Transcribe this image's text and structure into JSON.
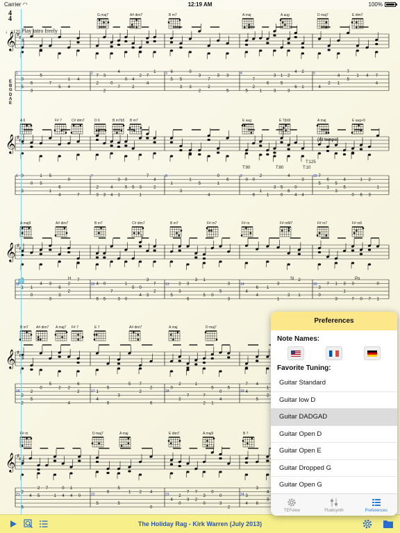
{
  "status": {
    "carrier": "Carrier",
    "time": "12:19 AM",
    "battery": "100%"
  },
  "score": {
    "time_signature_top": "4",
    "time_signature_bottom": "4",
    "tempo": "♩=125",
    "intro_text": "Play intro freely",
    "tab_strings": "E B G D A E",
    "rows": [
      {
        "chords": [
          "G maj7",
          "A# dim7",
          "B m7",
          "A maj",
          "A aug",
          "D maj7",
          "E dim7"
        ],
        "measures": [
          "1",
          "2",
          "3",
          "4",
          "5"
        ]
      },
      {
        "chords": [
          "A 6",
          "F# 7",
          "C# dim7",
          "D 6",
          "B m7b5",
          "B m7",
          "E aug",
          "E 7(b9)",
          "A maj",
          "E aug+9"
        ],
        "measures": [
          "6",
          "7",
          "8",
          "9",
          "10"
        ]
      },
      {
        "chords": [
          "A maj9",
          "A# dim7",
          "B m7",
          "C# dim7",
          "B m7",
          "F# m7",
          "F# m",
          "F# mM7",
          "F# m7",
          "F# m6"
        ],
        "measures": [
          "11",
          "12",
          "13",
          "14",
          "15"
        ]
      },
      {
        "chords": [
          "B m7",
          "A# dim7",
          "A maj7",
          "F# 7",
          "E 7",
          "A# dim7",
          "A maj",
          "D maj7"
        ],
        "measures": [
          "16",
          "17",
          "18",
          "19"
        ]
      },
      {
        "chords": [
          "F# m",
          "D maj7",
          "A maj",
          "E dim7",
          "A maj9",
          "B 7"
        ],
        "measures": [
          "21",
          "22",
          "23",
          "24"
        ]
      }
    ],
    "annotations": [
      "(At tempo)",
      "T:90",
      "T:80",
      "T:10",
      "T:125",
      "H",
      "Sl",
      "Po"
    ]
  },
  "preferences": {
    "title": "Preferences",
    "note_names_label": "Note Names:",
    "flags": [
      "us-flag",
      "france-flag",
      "germany-flag"
    ],
    "favorite_tuning_label": "Favorite Tuning:",
    "tunings": [
      "Guitar Standard",
      "Guitar low D",
      "Guitar DADGAD",
      "Guitar Open D",
      "Guitar Open E",
      "Guitar Dropped G",
      "Guitar Open G"
    ],
    "selected_tuning": "Guitar DADGAD",
    "tabs": [
      {
        "label": "TEFview",
        "icon": "gear-icon"
      },
      {
        "label": "Fluidsynth",
        "icon": "sliders-icon"
      },
      {
        "label": "Preferences",
        "icon": "list-icon"
      }
    ],
    "active_tab": "Preferences"
  },
  "toolbar": {
    "title": "The Holiday Rag - Kirk Warren (July 2013)"
  },
  "colors": {
    "toolbar_bg": "#f7f08a",
    "prefs_header": "#fce78a",
    "accent": "#2a7ad5",
    "title_blue": "#2a55b5"
  }
}
